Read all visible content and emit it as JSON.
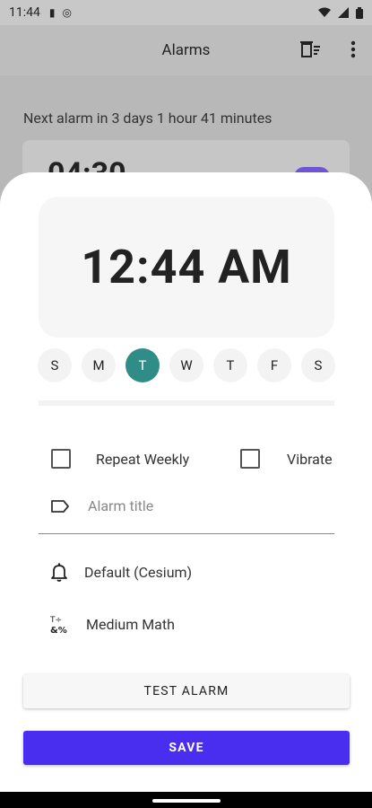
{
  "status_bar": {
    "time": "11:44",
    "left_icons": [
      "sd-card-icon",
      "at-sign-icon"
    ],
    "right_icons": [
      "wifi-icon",
      "signal-icon",
      "battery-icon"
    ]
  },
  "app_bar": {
    "title": "Alarms",
    "actions": [
      "delete-list-icon",
      "more-vert-icon"
    ]
  },
  "background": {
    "next_alarm_text": "Next alarm in  3 days 1 hour 41 minutes",
    "partial_alarm_time": "04:30"
  },
  "sheet": {
    "time": "12:44 AM",
    "days": [
      {
        "label": "S",
        "selected": false
      },
      {
        "label": "M",
        "selected": false
      },
      {
        "label": "T",
        "selected": true
      },
      {
        "label": "W",
        "selected": false
      },
      {
        "label": "T",
        "selected": false
      },
      {
        "label": "F",
        "selected": false
      },
      {
        "label": "S",
        "selected": false
      }
    ],
    "repeat_weekly_label": "Repeat Weekly",
    "vibrate_label": "Vibrate",
    "alarm_title_placeholder": "Alarm title",
    "ringtone_label": "Default (Cesium)",
    "challenge_label": "Medium Math",
    "test_button": "TEST ALARM",
    "save_button": "SAVE"
  },
  "colors": {
    "accent_teal": "#2f8c87",
    "primary_purple": "#4a2ef0",
    "scrim_gray": "#b8b8b8"
  }
}
